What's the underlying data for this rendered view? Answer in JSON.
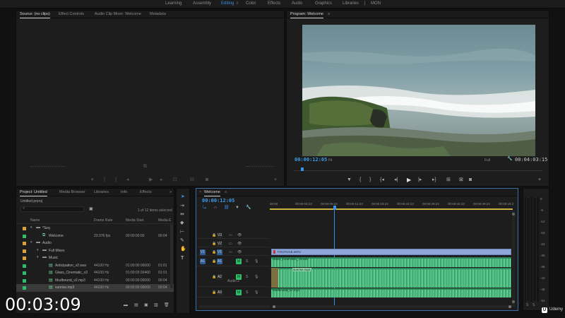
{
  "workspaces": [
    "Learning",
    "Assembly",
    "Editing",
    "Color",
    "Effects",
    "Audio",
    "Graphics",
    "Libraries",
    "MON"
  ],
  "active_workspace": "Editing",
  "source_panel": {
    "tabs": [
      "Source: (no clips)",
      "Effect Controls",
      "Audio Clip Mixer: Welcome",
      "Metadata"
    ]
  },
  "program_panel": {
    "tab": "Program: Welcome",
    "timecode": "00:00:12:05",
    "fit": "Fit",
    "full": "Full",
    "duration": "00:04:03:15"
  },
  "project_panel": {
    "tabs": [
      "Project: Untitled",
      "Media Browser",
      "Libraries",
      "Info",
      "Effects"
    ],
    "file": "Untitled.prproj",
    "items_selected": "1 of 12 items selected",
    "columns": [
      "Name",
      "Frame Rate",
      "Media Start",
      "Media E"
    ],
    "rows": [
      {
        "name": "*Seq",
        "rate": "",
        "start": "",
        "end": "",
        "color": "#d8a13a",
        "kind": "folder",
        "depth": 1
      },
      {
        "name": "Welcome",
        "rate": "23.976 fps",
        "start": "00:00:00:00",
        "end": "00:04",
        "color": "#2fbf6b",
        "kind": "seq",
        "depth": 2
      },
      {
        "name": "Audio",
        "rate": "",
        "start": "",
        "end": "",
        "color": "#d8a13a",
        "kind": "folder",
        "depth": 1
      },
      {
        "name": "Full Mixes",
        "rate": "",
        "start": "",
        "end": "",
        "color": "#d8a13a",
        "kind": "folder",
        "depth": 2
      },
      {
        "name": "Music",
        "rate": "",
        "start": "",
        "end": "",
        "color": "#d8a13a",
        "kind": "folder",
        "depth": 2
      },
      {
        "name": "Anticipation_v2.wav",
        "rate": "44100 Hz",
        "start": "01:00:00:00000",
        "end": "01:01",
        "color": "#2fbf6b",
        "kind": "audio",
        "depth": 3
      },
      {
        "name": "Glass_Cinematic_v3",
        "rate": "44100 Hz",
        "start": "01:00:03:26460",
        "end": "01:01",
        "color": "#2fbf6b",
        "kind": "audio",
        "depth": 3
      },
      {
        "name": "Mudbound_v2.mp3",
        "rate": "44100 Hz",
        "start": "00:00:00:00000",
        "end": "00:04",
        "color": "#2fbf6b",
        "kind": "audio",
        "depth": 3
      },
      {
        "name": "sunrise.mp3",
        "rate": "44100 Hz",
        "start": "00:00:00:00000",
        "end": "00:04",
        "color": "#2fbf6b",
        "kind": "audio",
        "depth": 3
      }
    ]
  },
  "timeline": {
    "tab": "Welcome",
    "timecode": "00:00:12:05",
    "ruler": [
      "00:00",
      "00:00:04:23",
      "00:00:09:23",
      "00:00:14:23",
      "00:00:19:23",
      "00:00:24:23",
      "00:00:29:23",
      "00:00:34:23",
      "00:00:39:23",
      "00:00:44:2"
    ],
    "video_tracks": [
      "V3",
      "V2",
      "V1"
    ],
    "audio_tracks": [
      "A1",
      "A2",
      "A3"
    ],
    "v1_source": "V1",
    "a1_source": "A1",
    "v1_clip": "FOOTAGE.MOV",
    "a1_clip": "Glass_Cinematic_v3.wav",
    "a2_label": "Audio 2",
    "a2_clip": "sunrise.mp3",
    "a3_clip": "Mudbound_v2.mp3"
  },
  "meter_scale": [
    "0",
    "-6",
    "-12",
    "-18",
    "-24",
    "-30",
    "-36",
    "-42",
    "-48",
    "-54"
  ],
  "meter_footer": [
    "S",
    "S"
  ],
  "overlay_time": "00:03:09",
  "brand": "Udemy",
  "colors": {
    "accent": "#3b8fe6",
    "audio_clip": "#2a8a5a",
    "video_clip": "#8fa7d8"
  }
}
